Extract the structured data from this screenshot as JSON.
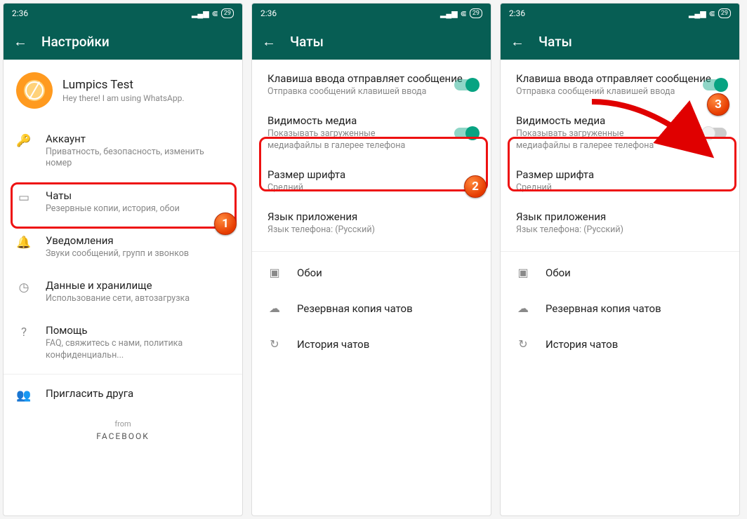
{
  "status": {
    "time": "2:36",
    "battery": "29"
  },
  "screen1": {
    "title": "Настройки",
    "profile": {
      "name": "Lumpics Test",
      "status": "Hey there! I am using WhatsApp."
    },
    "items": [
      {
        "icon": "key",
        "title": "Аккаунт",
        "sub": "Приватность, безопасность, изменить номер"
      },
      {
        "icon": "chat",
        "title": "Чаты",
        "sub": "Резервные копии, история, обои"
      },
      {
        "icon": "bell",
        "title": "Уведомления",
        "sub": "Звуки сообщений, групп и звонков"
      },
      {
        "icon": "data",
        "title": "Данные и хранилище",
        "sub": "Использование сети, автозагрузка"
      },
      {
        "icon": "help",
        "title": "Помощь",
        "sub": "FAQ, свяжитесь с нами, политика конфиденциальн..."
      },
      {
        "icon": "invite",
        "title": "Пригласить друга",
        "sub": ""
      }
    ],
    "from": "from",
    "facebook": "FACEBOOK"
  },
  "chats": {
    "title": "Чаты",
    "rows": {
      "enter": {
        "t": "Клавиша ввода отправляет сообщение",
        "s": "Отправка сообщений клавишей ввода"
      },
      "media": {
        "t": "Видимость медиа",
        "s": "Показывать загруженные медиафайлы в галерее телефона"
      },
      "font": {
        "t": "Размер шрифта",
        "s": "Средний"
      },
      "lang": {
        "t": "Язык приложения",
        "s": "Язык телефона: (Русский)"
      }
    },
    "links": {
      "wallpaper": "Обои",
      "backup": "Резервная копия чатов",
      "history": "История чатов"
    }
  },
  "badges": {
    "one": "1",
    "two": "2",
    "three": "3"
  }
}
